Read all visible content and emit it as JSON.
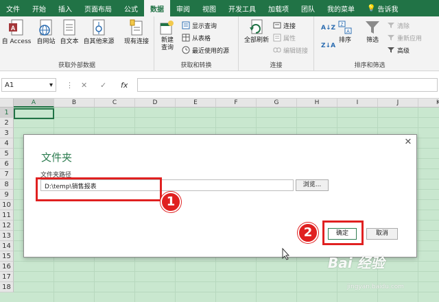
{
  "tabs": [
    {
      "label": "文件",
      "active": false
    },
    {
      "label": "开始",
      "active": false
    },
    {
      "label": "插入",
      "active": false
    },
    {
      "label": "页面布局",
      "active": false
    },
    {
      "label": "公式",
      "active": false
    },
    {
      "label": "数据",
      "active": true
    },
    {
      "label": "审阅",
      "active": false
    },
    {
      "label": "视图",
      "active": false
    },
    {
      "label": "开发工具",
      "active": false
    },
    {
      "label": "加载项",
      "active": false
    },
    {
      "label": "团队",
      "active": false
    },
    {
      "label": "我的菜单",
      "active": false
    },
    {
      "label": "告诉我",
      "active": false
    }
  ],
  "ribbon": {
    "external": {
      "label": "获取外部数据",
      "access": "自 Access",
      "web": "自网站",
      "text": "自文本",
      "other": "自其他来源",
      "existing": "现有连接"
    },
    "transform": {
      "label": "获取和转换",
      "newquery_1": "新建",
      "newquery_2": "查询",
      "show": "显示查询",
      "fromtable": "从表格",
      "recent": "最近使用的源"
    },
    "connections": {
      "label": "连接",
      "refresh": "全部刷新",
      "conn": "连接",
      "props": "属性",
      "editlinks": "编辑链接"
    },
    "sort": {
      "label": "排序和筛选",
      "az": "A↓Z",
      "za": "Z↓A",
      "sort": "排序",
      "filter": "筛选",
      "clear": "清除",
      "reapply": "重新应用",
      "advanced": "高级"
    }
  },
  "formula_bar": {
    "name_box": "A1",
    "cancel": "✕",
    "enter": "✓",
    "fx": "fx",
    "value": ""
  },
  "grid": {
    "columns": [
      "A",
      "B",
      "C",
      "D",
      "E",
      "F",
      "G",
      "H",
      "I",
      "J",
      "K"
    ],
    "rows": [
      "1",
      "2",
      "3",
      "4",
      "5",
      "6",
      "7",
      "8",
      "9",
      "10",
      "11",
      "12",
      "13",
      "14",
      "15",
      "16",
      "17",
      "18"
    ],
    "selected_cell": "A1"
  },
  "dialog": {
    "title": "文件夹",
    "path_label": "文件夹路径",
    "path_value": "D:\\temp\\销售报表",
    "browse": "浏览...",
    "ok": "确定",
    "cancel": "取消",
    "close": "✕"
  },
  "annotations": {
    "step1": "1",
    "step2": "2",
    "highlight_color": "#e02020"
  },
  "watermark": {
    "brand": "Bai 经验",
    "url": "jingyan.baidu.com"
  },
  "colors": {
    "accent": "#217346",
    "sheet": "#c9e7cf",
    "dialog_title": "#2e7d51"
  }
}
